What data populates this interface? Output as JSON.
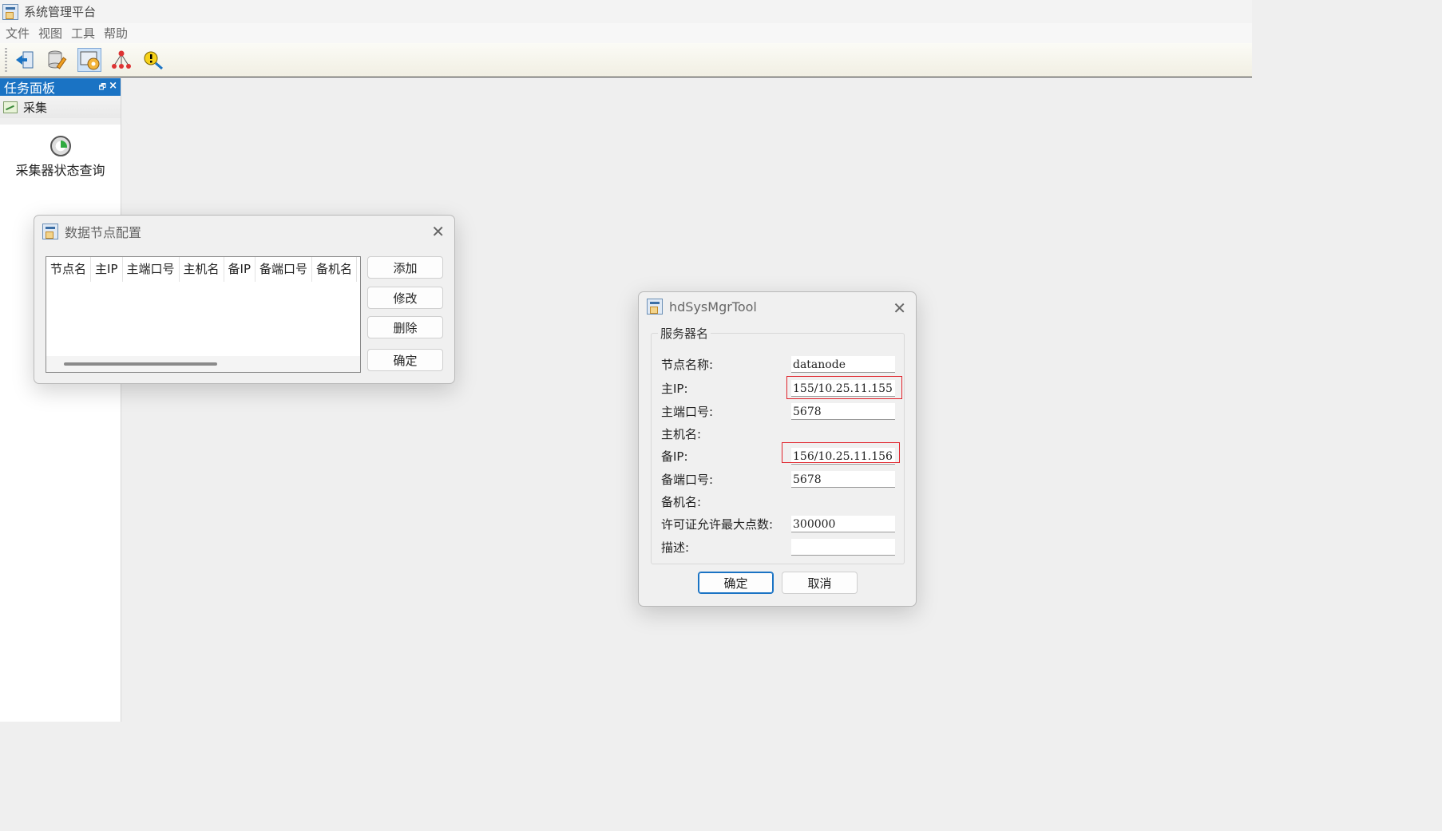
{
  "app": {
    "title": "系统管理平台"
  },
  "menu": {
    "items": [
      "文件",
      "视图",
      "工具",
      "帮助"
    ]
  },
  "toolbar": {
    "buttons": [
      "exit-icon",
      "db-tool-icon",
      "settings-icon",
      "network-icon",
      "warning-search-icon"
    ]
  },
  "panel": {
    "title": "任务面板",
    "category": "采集",
    "items": [
      {
        "label": "采集器状态查询",
        "icon": "gauge-icon"
      }
    ]
  },
  "node_dialog": {
    "title": "数据节点配置",
    "columns": [
      "节点名",
      "主IP",
      "主端口号",
      "主机名",
      "备IP",
      "备端口号",
      "备机名"
    ],
    "rows": [],
    "buttons": {
      "add": "添加",
      "edit": "修改",
      "delete": "删除",
      "ok": "确定"
    }
  },
  "tool_dialog": {
    "title": "hdSysMgrTool",
    "group": "服务器名",
    "fields": {
      "node_name": {
        "label": "节点名称:",
        "value": "datanode"
      },
      "primary_ip": {
        "label": "主IP:",
        "value": "155/10.25.11.155"
      },
      "primary_port": {
        "label": "主端口号:",
        "value": "5678"
      },
      "primary_host": {
        "label": "主机名:"
      },
      "backup_ip": {
        "label": "备IP:",
        "value": "156/10.25.11.156"
      },
      "backup_port": {
        "label": "备端口号:",
        "value": "5678"
      },
      "backup_host": {
        "label": "备机名:"
      },
      "license_max": {
        "label": "许可证允许最大点数:",
        "value": "300000"
      },
      "description": {
        "label": "描述:",
        "value": ""
      }
    },
    "buttons": {
      "ok": "确定",
      "cancel": "取消"
    }
  },
  "colors": {
    "accent": "#1a73c4",
    "highlight": "#e0222a"
  }
}
